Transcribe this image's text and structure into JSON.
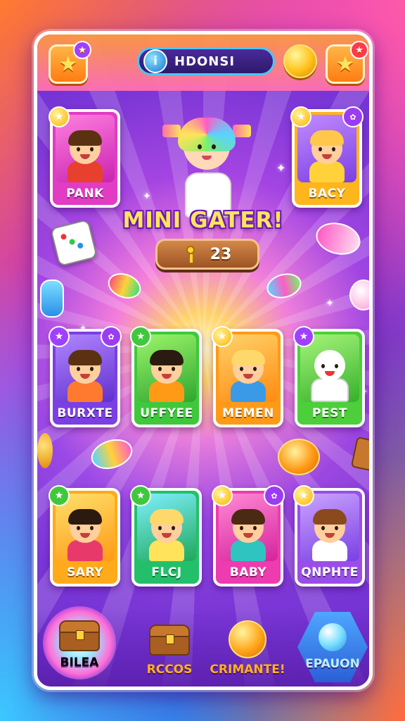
{
  "header": {
    "title": "HDONSI",
    "info_icon": "i",
    "left_button_icon": "star-icon",
    "right_button_icon": "star-icon"
  },
  "hero": {
    "headline": "MINI GATER!",
    "score_icon": "key-icon",
    "score": "23"
  },
  "cards": [
    {
      "label": "PANK",
      "color": "#e23bc4"
    },
    {
      "label": "BACY",
      "color": "#ffb51c"
    },
    {
      "label": "BURXTE",
      "color": "#7b3fe4"
    },
    {
      "label": "UFFYEE",
      "color": "#3fc83c"
    },
    {
      "label": "MEMEN",
      "color": "#ff9a17"
    },
    {
      "label": "PEST",
      "color": "#4ccf3a"
    },
    {
      "label": "SARY",
      "color": "#ffaa1a"
    },
    {
      "label": "FLCJ",
      "color": "#22c06a"
    },
    {
      "label": "BABY",
      "color": "#ee3bb0"
    },
    {
      "label": "QNPHTE",
      "color": "#9a4ee8"
    }
  ],
  "nav": [
    {
      "label": "BILEA",
      "icon": "treasure-chest-icon",
      "color": "#ffffff"
    },
    {
      "label": "RCCOS",
      "icon": "chest-icon",
      "color": "#ffb21c"
    },
    {
      "label": "CRIMANTE!",
      "icon": "coin-icon",
      "color": "#ffb21c"
    },
    {
      "label": "EPAUON",
      "icon": "crystal-ball-icon",
      "color": "#bdf1ff"
    }
  ],
  "colors": {
    "accent": "#ffe45c",
    "frame": "#7b36d6",
    "title_border": "#49c6ff"
  }
}
